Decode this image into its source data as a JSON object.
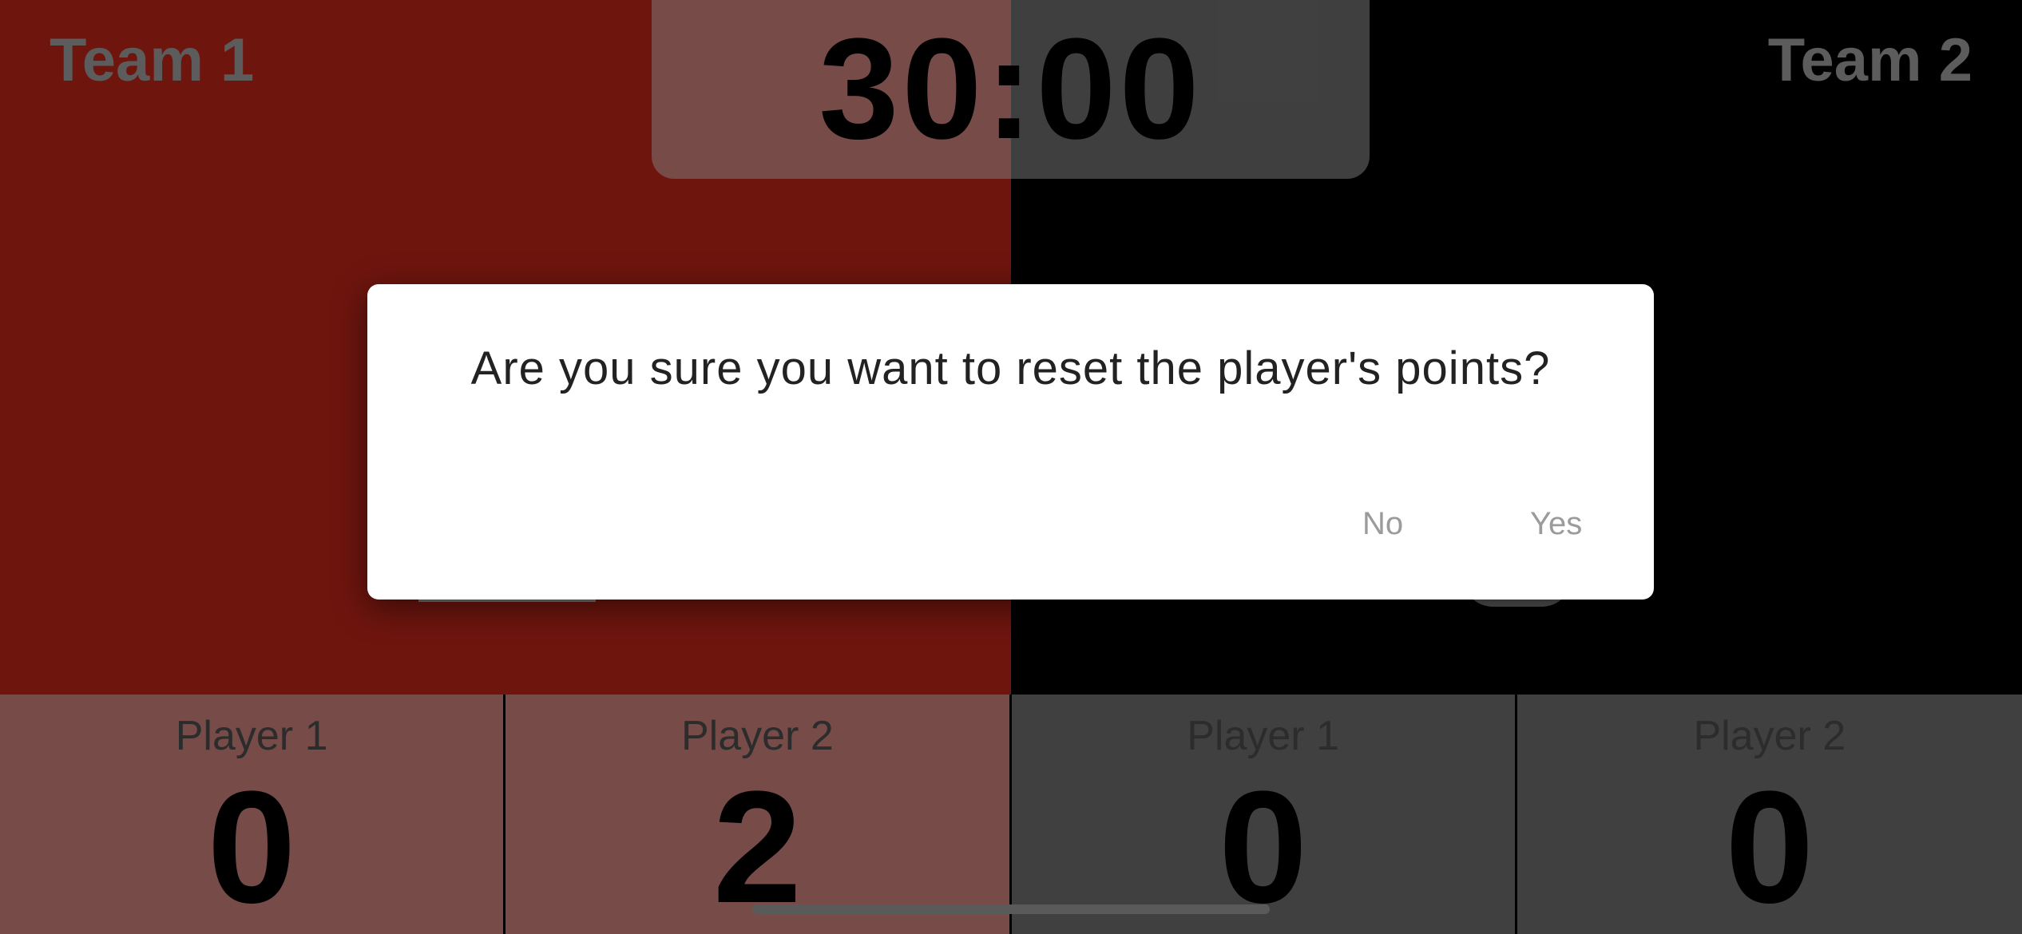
{
  "timer": "30:00",
  "teams": {
    "team1": {
      "name": "Team 1",
      "color": "#b82318"
    },
    "team2": {
      "name": "Team 2",
      "color": "#000000"
    }
  },
  "players": [
    {
      "label": "Player 1",
      "score": "0"
    },
    {
      "label": "Player 2",
      "score": "2"
    },
    {
      "label": "Player 1",
      "score": "0"
    },
    {
      "label": "Player 2",
      "score": "0"
    }
  ],
  "dialog": {
    "message": "Are you sure you want to reset the player's points?",
    "no_label": "No",
    "yes_label": "Yes"
  }
}
